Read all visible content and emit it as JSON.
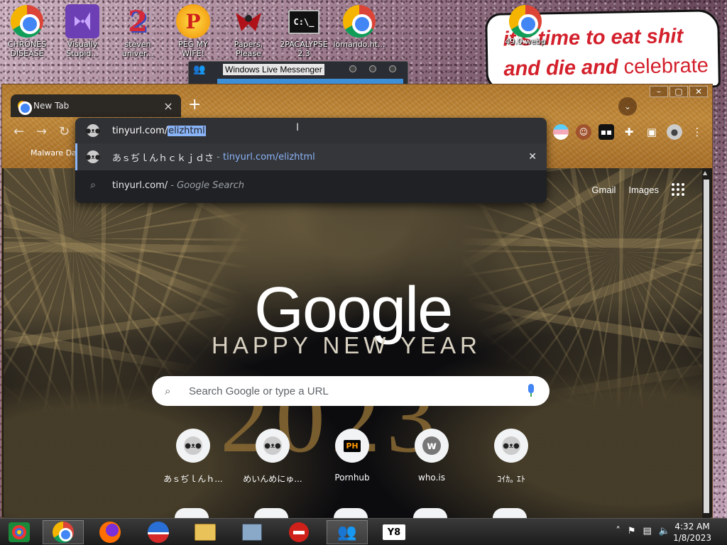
{
  "desktop": {
    "icons": [
      {
        "label": "CHRONES\nDISEASE",
        "icon": "chrome-icon"
      },
      {
        "label": "Visually\nStupid...",
        "icon": "visual-studio-icon"
      },
      {
        "label": "steven\nuniver...",
        "icon": "steven-universe-icon"
      },
      {
        "label": "PEG MY WIFE!",
        "icon": "peggle-icon"
      },
      {
        "label": "Papers,\nPlease",
        "icon": "papers-please-icon"
      },
      {
        "label": "2PACALYPSE\n2.3",
        "icon": "terminal-icon"
      },
      {
        "label": "lomando.ht...",
        "icon": "chrome-icon"
      },
      {
        "label": "49.0.webp",
        "icon": "chrome-icon"
      }
    ],
    "sign": {
      "line1": "it's time to eat shit",
      "line2_bold": "and die and",
      "line2_normal": "celebrate"
    },
    "messenger_title": "Windows Live Messenger"
  },
  "browser": {
    "tab_title": "New Tab",
    "tab_close": "×",
    "new_tab": "+",
    "bookmark_label": "Malware Dat",
    "omnibox": {
      "typed": "tinyurl.com/",
      "autocomplete_selected": "elizhtml",
      "suggestions": [
        {
          "title": "あｓぢｌんｈｃｋｊｄさ",
          "separator": " - ",
          "url": "tinyurl.com/elizhtml"
        },
        {
          "title": "tinyurl.com/",
          "separator": " - ",
          "sub": "Google Search"
        }
      ]
    },
    "page": {
      "top_links": [
        "Gmail",
        "Images"
      ],
      "doodle_word": "Google",
      "doodle_sub": "HAPPY NEW YEAR",
      "doodle_year": "2023",
      "search_placeholder": "Search Google or type a URL",
      "shortcuts": [
        {
          "label": "あｓぢｌんｈ...",
          "icon": "kitty-icon"
        },
        {
          "label": "めいんめにゅ...",
          "icon": "kitty-icon"
        },
        {
          "label": "Pornhub",
          "icon": "ph-icon",
          "icon_text": "PH"
        },
        {
          "label": "who.is",
          "icon": "who-is-icon",
          "icon_text": "w"
        },
        {
          "label": "ｺｲｶ｡ ｴﾄ",
          "icon": "kitty-icon"
        }
      ]
    }
  },
  "taskbar": {
    "clock_time": "4:32 AM",
    "clock_date": "1/8/2023"
  }
}
